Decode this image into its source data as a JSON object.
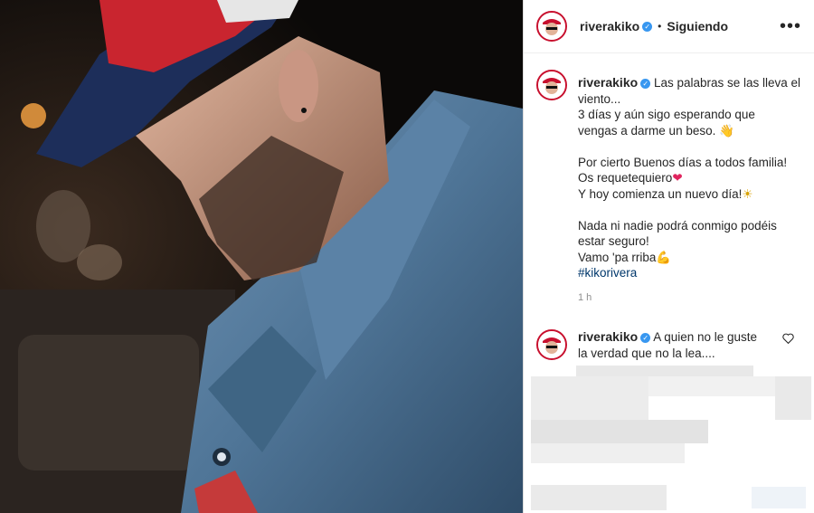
{
  "post": {
    "username": "riverakiko",
    "follow_status": "Siguiendo",
    "more_icon": "more-options-icon",
    "caption_lines": [
      "Las palabras se las lleva el",
      "viento...",
      "3 días y aún sigo esperando que",
      "vengas a darme un beso.",
      "Por cierto Buenos días a todos familia!",
      "Os requetequiero",
      "Y hoy comienza un nuevo día!",
      "Nada ni nadie podrá conmigo podéis",
      "estar seguro!",
      "Vamo 'pa rriba",
      "#kikorivera"
    ],
    "time_ago": "1 h"
  },
  "comment": {
    "username": "riverakiko",
    "text_line1": "A quien no le guste",
    "text_line2": "la verdad que no la lea...."
  },
  "colors": {
    "verified": "#3897f0",
    "hashtag": "#00376b",
    "heart": "#e0245e"
  }
}
